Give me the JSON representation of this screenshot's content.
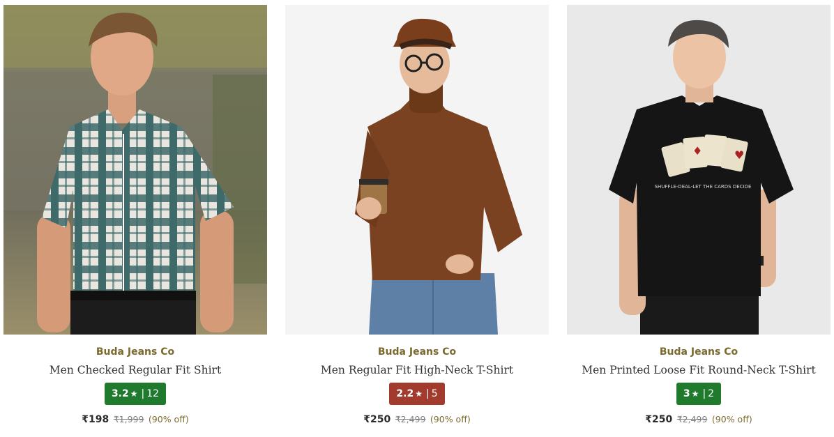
{
  "products": [
    {
      "brand": "Buda Jeans Co",
      "title": "Men Checked Regular Fit Shirt",
      "rating": {
        "score": "3.2",
        "count": "12",
        "color": "#1f7a2e"
      },
      "price": "₹198",
      "mrp": "₹1,999",
      "discount": "(90% off)",
      "image": "man-in-checked-shirt-photo"
    },
    {
      "brand": "Buda Jeans Co",
      "title": "Men Regular Fit High-Neck T-Shirt",
      "rating": {
        "score": "2.2",
        "count": "5",
        "color": "#a23a2e"
      },
      "price": "₹250",
      "mrp": "₹2,499",
      "discount": "(90% off)",
      "image": "man-in-brown-turtleneck-photo"
    },
    {
      "brand": "Buda Jeans Co",
      "title": "Men Printed Loose Fit Round-Neck T-Shirt",
      "rating": {
        "score": "3",
        "count": "2",
        "color": "#1f7a2e"
      },
      "price": "₹250",
      "mrp": "₹2,499",
      "discount": "(90% off)",
      "image": "man-in-black-printed-tshirt-photo",
      "print_text": "SHUFFLE-DEAL-LET THE CARDS DECIDE"
    }
  ],
  "star_glyph": "★",
  "separator": "|"
}
